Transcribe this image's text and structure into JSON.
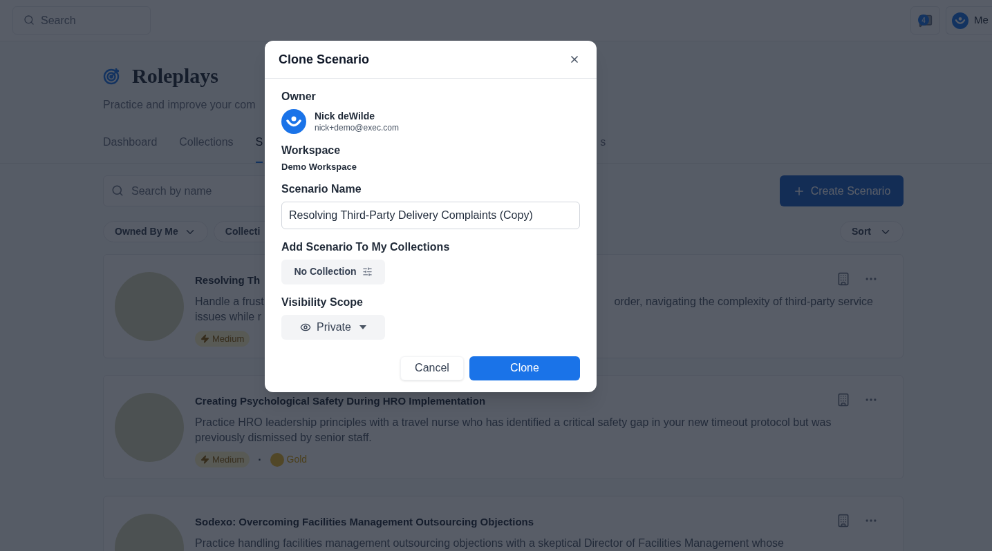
{
  "top_bar": {
    "search": {
      "placeholder": "Search"
    },
    "notification_count": "4",
    "user_label": "Me"
  },
  "page": {
    "title": "Roleplays",
    "subtitle": "Practice and improve your com",
    "tabs": [
      {
        "label": "Dashboard",
        "selected": false
      },
      {
        "label": "Collections",
        "selected": false
      },
      {
        "label": "S",
        "selected": true
      },
      {
        "label": "s",
        "selected": false
      }
    ],
    "search": {
      "placeholder": "Search by name"
    },
    "create_button": "Create Scenario",
    "filters": [
      "Owned By Me",
      "Collecti"
    ],
    "sort": "Sort",
    "tag_separator": "·",
    "cards": [
      {
        "title": "Resolving Th",
        "lines": [
          {
            "left": "Handle a frust",
            "right": "order, navigating the complexity of third-party service"
          },
          {
            "left": "issues while r"
          }
        ],
        "tags": [
          {
            "kind": "difficulty",
            "label": "Medium"
          }
        ]
      },
      {
        "title": "Creating Psychological Safety During HRO Implementation",
        "lines": [
          {
            "left": "Practice HRO leadership principles with a travel nurse who has identified a critical safety gap in your new timeout protocol but was"
          },
          {
            "left": "previously dismissed by senior staff."
          }
        ],
        "tags": [
          {
            "kind": "difficulty",
            "label": "Medium"
          },
          {
            "kind": "medal",
            "label": "Gold"
          }
        ]
      },
      {
        "title": "Sodexo: Overcoming Facilities Management Outsourcing Objections",
        "lines": [
          {
            "left": "Practice handling facilities management outsourcing objections with a skeptical Director of Facilities Management whose"
          }
        ]
      }
    ]
  },
  "dialog": {
    "title": "Clone Scenario",
    "owner": {
      "label": "Owner",
      "name": "Nick deWilde",
      "email": "nick+demo@exec.com"
    },
    "workspace": {
      "label": "Workspace",
      "value": "Demo Workspace"
    },
    "scenario_name": {
      "label": "Scenario Name",
      "value": "Resolving Third-Party Delivery Complaints (Copy)"
    },
    "collections": {
      "label": "Add Scenario To My Collections",
      "value": "No Collection"
    },
    "visibility": {
      "label": "Visibility Scope",
      "value": "Private"
    },
    "buttons": {
      "cancel": "Cancel",
      "confirm": "Clone"
    }
  }
}
